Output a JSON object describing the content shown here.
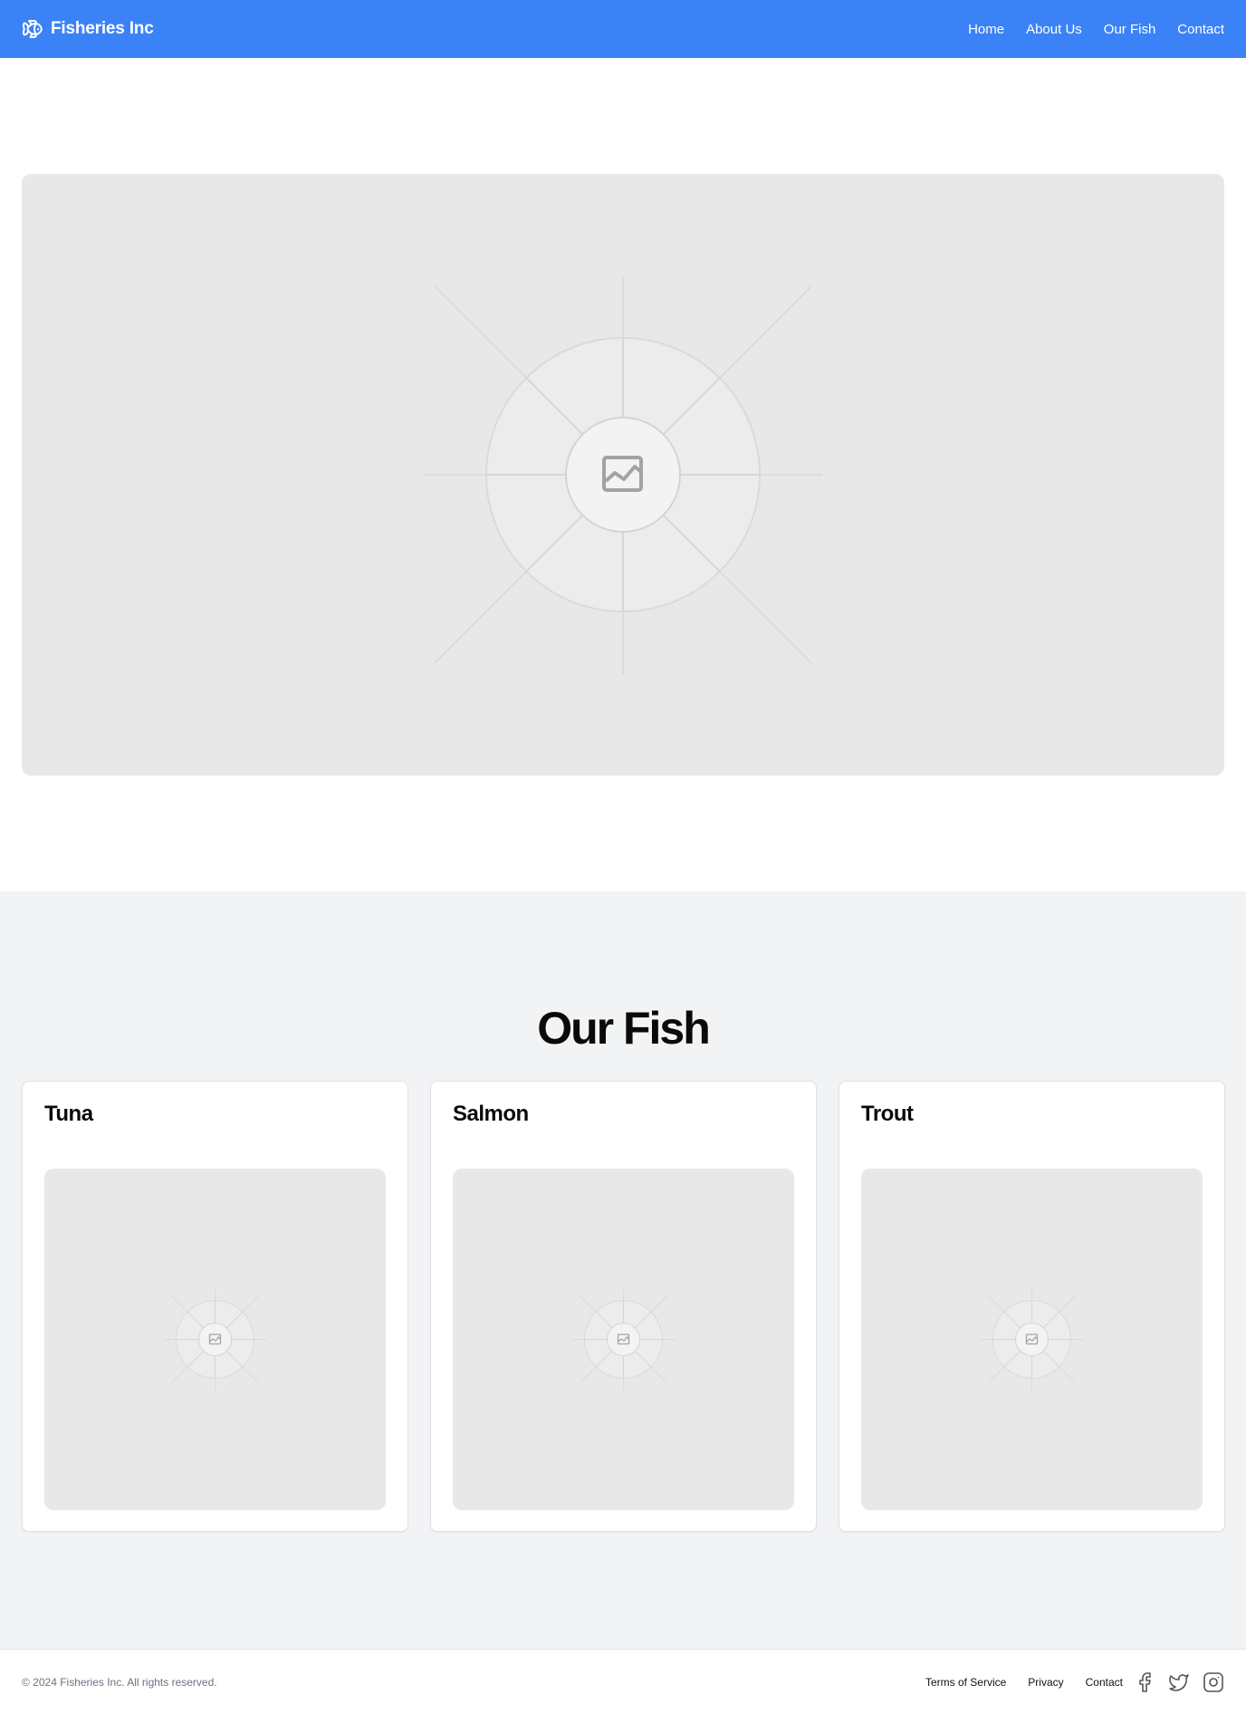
{
  "header": {
    "brand_name": "Fisheries Inc",
    "nav": [
      "Home",
      "About Us",
      "Our Fish",
      "Contact"
    ]
  },
  "fish_section": {
    "title": "Our Fish",
    "cards": [
      {
        "name": "Tuna"
      },
      {
        "name": "Salmon"
      },
      {
        "name": "Trout"
      }
    ]
  },
  "footer": {
    "copyright": "© 2024 Fisheries Inc. All rights reserved.",
    "links": [
      "Terms of Service",
      "Privacy",
      "Contact"
    ],
    "social_icons": [
      "facebook-icon",
      "twitter-icon",
      "instagram-icon"
    ]
  },
  "colors": {
    "header_bg": "#3b82f6",
    "section_bg": "#f2f3f5",
    "placeholder_bg": "#e8e8e8"
  }
}
